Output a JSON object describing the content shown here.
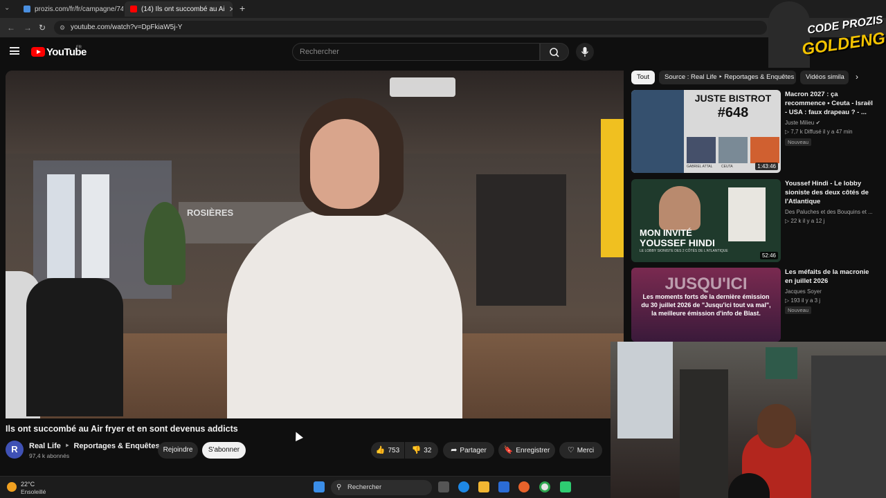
{
  "browser": {
    "tabs": [
      {
        "label": "prozis.com/fr/fr/campagne/74",
        "close": "✕"
      },
      {
        "label": "(14) Ils ont succombé au Ai",
        "close": "✕"
      }
    ],
    "new_tab": "+",
    "url": "youtube.com/watch?v=DpFkiaW5j-Y"
  },
  "youtube": {
    "logo": "YouTube",
    "region": "FR",
    "search_placeholder": "Rechercher",
    "video": {
      "title": "Ils ont succombé au Air fryer et en sont devenus addicts",
      "channel": "Real Life",
      "channel_separator": "‣",
      "playlist": "Reportages & Enquêtes",
      "avatar_letter": "R",
      "subscribers": "97,4 k abonnés",
      "join_label": "Rejoindre",
      "subscribe_label": "S'abonner",
      "likes": "753",
      "dislikes": "32",
      "share_label": "Partager",
      "save_label": "Enregistrer",
      "thanks_label": "Merci",
      "overlay_text_rosieres": "ROSIÈRES"
    },
    "chips": [
      "Tout",
      "Source : Real Life ‣ Reportages & Enquêtes",
      "Vidéos simila"
    ],
    "recommendations": [
      {
        "title": "Macron 2027 : ça recommence • Ceuta - Israël - USA : faux drapeau ? - ...",
        "channel": "Juste Milieu",
        "meta": "▷ 7,7 k  Diffusé il y a 47 min",
        "badge": "Nouveau",
        "duration": "1:43:46",
        "thumb_text_1": "JUSTE BISTROT",
        "thumb_text_2": "#648",
        "thumb_labels": [
          "GABRIEL ATTAL",
          "CEUTA"
        ]
      },
      {
        "title": "Youssef Hindi - Le lobby sioniste des deux côtés de l'Atlantique",
        "channel": "Des Paluches et des Bouquins et ...",
        "meta": "▷ 22 k  il y a 12 j",
        "badge": "",
        "duration": "52:46",
        "thumb_text_1": "MON INVITÉ",
        "thumb_text_2": "YOUSSEF HINDI",
        "thumb_text_3": "LE LOBBY SIONISTE DES 2 CÔTÉS DE L'ATLANTIQUE"
      },
      {
        "title": "Les méfaits de la macronie en juillet 2026",
        "channel": "Jacques Soyer",
        "meta": "▷ 193  il y a 3 j",
        "badge": "Nouveau",
        "duration": "",
        "thumb_text_1": "JUSQU'ICI",
        "thumb_text_2": "Les moments forts de la dernière émission du 30 juillet 2026 de \"Jusqu'ici tout va mal\", la meilleure émission d'info de Blast."
      }
    ]
  },
  "overlay": {
    "logo_line1": "CODE PROZIS",
    "logo_line2": "GOLDENG"
  },
  "taskbar": {
    "temperature": "22°C",
    "condition": "Ensoleillé",
    "search_label": "Rechercher"
  },
  "colors": {
    "yt_red": "#ff0000",
    "background": "#0f0f0f",
    "logo_gold": "#f2c200"
  }
}
